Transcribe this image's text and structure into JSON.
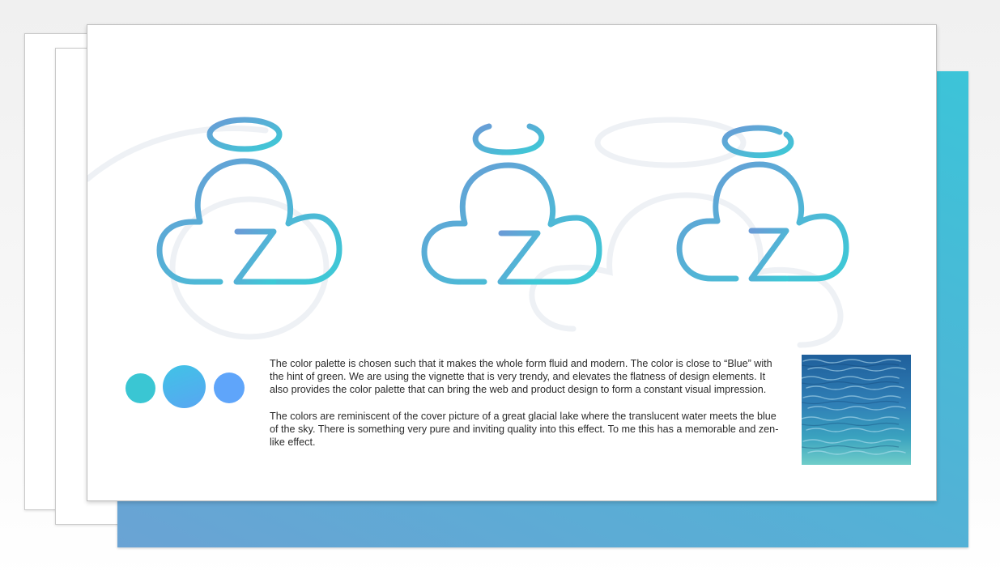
{
  "logo_variants": [
    {
      "name": "closed-halo",
      "letter": "Z"
    },
    {
      "name": "open-halo",
      "letter": "Z"
    },
    {
      "name": "gapped-halo",
      "letter": "Z"
    }
  ],
  "colors": {
    "gradient_start": "#6a9bd6",
    "gradient_end": "#3ccad6",
    "backdrop_start": "#3cc4d8",
    "backdrop_end": "#6aa3d4"
  },
  "palette": [
    {
      "name": "turquoise",
      "color": "#3ac6d3"
    },
    {
      "name": "cyan-blue",
      "color": "#4db5ec"
    },
    {
      "name": "sky-blue",
      "color": "#5fa5fa"
    }
  ],
  "description": {
    "paragraph_1": "The color palette is chosen such that it makes the whole form fluid and modern. The color is close to “Blue” with the hint of green. We are using the vignette that is very trendy, and elevates the flatness of design elements. It also provides the color palette that can bring the web and product design to form a constant visual impression.",
    "paragraph_2": "The colors are reminiscent of the cover picture of a great glacial lake where the translucent water meets the blue of the sky. There is something very pure and inviting quality into this effect. To me this has a memorable and zen-like effect."
  },
  "image": {
    "subject": "glacial-lake-water",
    "colors": [
      "#1e5f9a",
      "#3a8cc0",
      "#49b6c4",
      "#7fd3d0"
    ]
  }
}
